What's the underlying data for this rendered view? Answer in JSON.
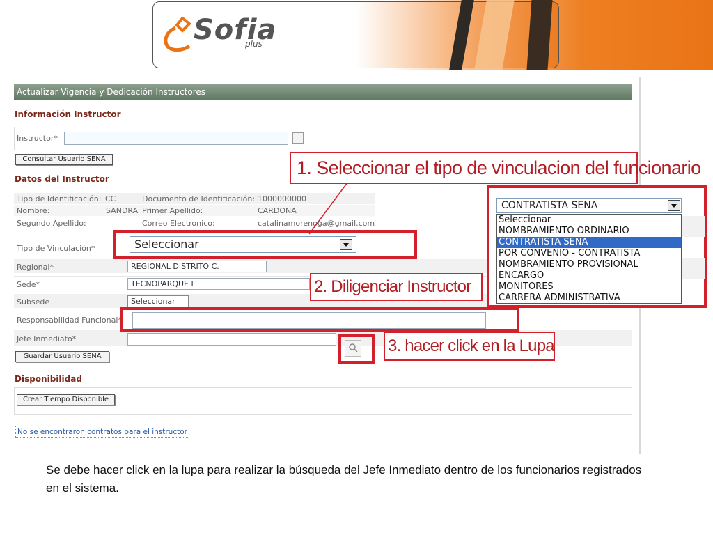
{
  "header": {
    "logo_text": "Sofia",
    "logo_sub": "plus"
  },
  "form": {
    "window_title": "Actualizar Vigencia y Dedicación Instructores",
    "section_info": "Información Instructor",
    "instructor_label": "Instructor*",
    "consultar_button": "Consultar Usuario SENA",
    "section_datos": "Datos del Instructor",
    "datos": {
      "tipo_id_label": "Tipo de Identificación:",
      "tipo_id_value": "CC",
      "doc_id_label": "Documento de Identificación:",
      "doc_id_value": "1000000000",
      "nombre_label": "Nombre:",
      "nombre_value": "SANDRA",
      "primer_apellido_label": "Primer Apellido:",
      "primer_apellido_value": "CARDONA",
      "segundo_apellido_label": "Segundo Apellido:",
      "correo_label": "Correo Electronico:",
      "correo_value": "catalinamorenoga@gmail.com"
    },
    "tipo_vinculacion_label": "Tipo de Vinculación*",
    "tipo_vinculacion_value": "Seleccionar",
    "regional_label": "Regional*",
    "regional_value": "REGIONAL DISTRITO C.",
    "sede_label": "Sede*",
    "sede_value": "TECNOPARQUE I",
    "subsede_label": "Subsede",
    "subsede_value": "Seleccionar",
    "responsabilidad_label": "Responsabilidad Funcional*",
    "jefe_label": "Jefe Inmediato*",
    "guardar_button": "Guardar Usuario SENA",
    "section_disponibilidad": "Disponibilidad",
    "crear_button": "Crear Tiempo Disponible",
    "no_contratos": "No se encontraron contratos para el instructor"
  },
  "dropdown": {
    "selected": "CONTRATISTA SENA",
    "options": [
      "Seleccionar",
      "NOMBRAMIENTO ORDINARIO",
      "CONTRATISTA SENA",
      "POR CONVENIO - CONTRATISTA",
      "NOMBRAMIENTO PROVISIONAL",
      "ENCARGO",
      "MONITORES",
      "CARRERA ADMINISTRATIVA"
    ],
    "highlighted_index": 2
  },
  "callouts": {
    "step1": "1. Seleccionar el tipo de vinculacion del funcionario",
    "step2": "2. Diligenciar Instructor",
    "step3": "3. hacer click en la Lupa"
  },
  "caption": "Se debe hacer click en la lupa para realizar la búsqueda del Jefe Inmediato dentro de los funcionarios registrados en el sistema.",
  "colors": {
    "accent_red": "#d3212b",
    "orange": "#ee7f22",
    "title_bar": "#6f8a72"
  }
}
